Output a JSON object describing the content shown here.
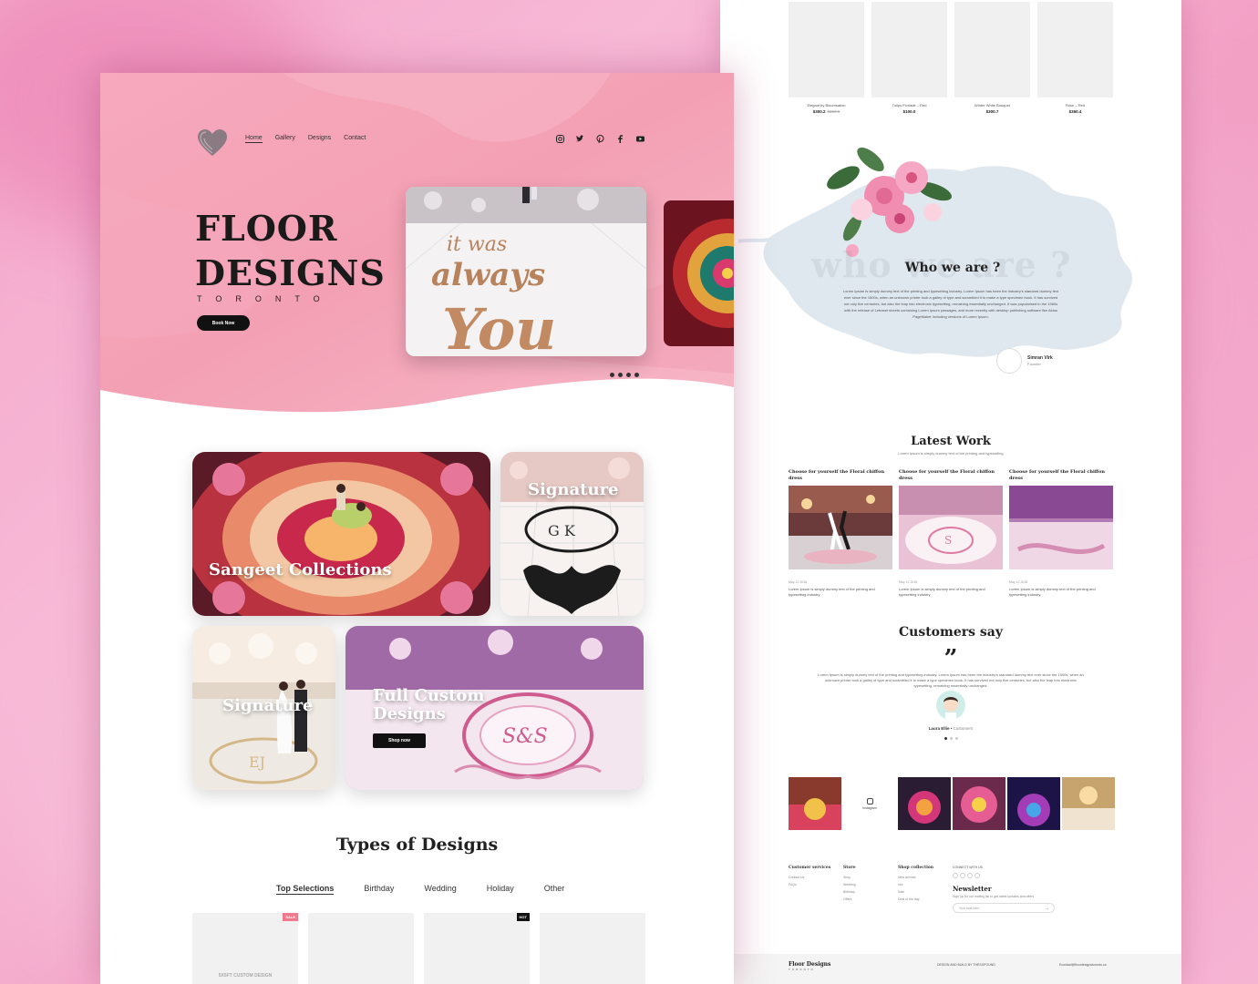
{
  "left": {
    "nav": [
      "Home",
      "Gallery",
      "Designs",
      "Contact"
    ],
    "social": [
      "instagram-icon",
      "twitter-icon",
      "pinterest-icon",
      "facebook-icon",
      "youtube-icon"
    ],
    "hero": {
      "title_line1": "FLOOR",
      "title_line2": "DESIGNS",
      "subtitle": "TORONTO",
      "cta": "Book Now",
      "slide_script_top": "it was",
      "slide_script_mid": "always",
      "slide_script_bottom": "You"
    },
    "collections": {
      "sangeet": "Sangeet Collections",
      "signature_top": "Signature",
      "signature_bottom": "Signature",
      "custom_line1": "Full Custom",
      "custom_line2": "Designs",
      "shop_now": "Shop now",
      "monogram_top": "G K",
      "monogram_custom": "S&S",
      "monogram_signature": "EJ"
    },
    "types": {
      "title": "Types of Designs",
      "tabs": [
        "Top Selections",
        "Birthday",
        "Wedding",
        "Holiday",
        "Other"
      ],
      "badges": [
        "SALE",
        "HOT"
      ],
      "first_card_name": "5X5FT CUSTOM DESIGN"
    }
  },
  "right": {
    "products": [
      {
        "name": "Elegant by Bloomsation",
        "price": "$300.2",
        "old_price": "$350.6"
      },
      {
        "name": "Tulips Floriade – Red",
        "price": "$100.0",
        "old_price": ""
      },
      {
        "name": "Winter White Bouquet",
        "price": "$300.7",
        "old_price": ""
      },
      {
        "name": "Rose – Red",
        "price": "$350.4",
        "old_price": ""
      }
    ],
    "who": {
      "ghost": "who we are ?",
      "title": "Who we are ?",
      "text": "Lorem Ipsum is simply dummy text of the printing and typesetting industry. Lorem Ipsum has been the industry's standard dummy text ever since the 1500s, when an unknown printer took a galley of type and scrambled it to make a type specimen book. It has survived not only five centuries, but also the leap into electronic typesetting, remaining essentially unchanged. It was popularised in the 1960s with the release of Letraset sheets containing Lorem Ipsum passages, and more recently with desktop publishing software like Aldus PageMaker including versions of Lorem Ipsum.",
      "name": "Simran Virk",
      "role": "Founder"
    },
    "latest": {
      "title": "Latest Work",
      "subtitle": "Lorem Ipsum is simply dummy text of the printing and typesetting",
      "items": [
        {
          "head": "Choose for yourself the Floral chiffon dress",
          "date": "May 12 2018",
          "text": "Lorem Ipsum is simply dummy text of the printing and typesetting industry."
        },
        {
          "head": "Choose for yourself the Floral chiffon dress",
          "date": "May 12 2018",
          "text": "Lorem Ipsum is simply dummy text of the printing and typesetting industry."
        },
        {
          "head": "Choose for yourself the Floral chiffon dress",
          "date": "May 12 2018",
          "text": "Lorem Ipsum is simply dummy text of the printing and typesetting industry."
        }
      ]
    },
    "customers": {
      "title": "Customers say",
      "quote": "”",
      "text": "Lorem Ipsum is simply dummy text of the printing and typesetting industry. Lorem Ipsum has been the industry's standard dummy text ever since the 1500s, when an unknown printer took a galley of type and scrambled it to make a type specimen book. It has survived not only five centuries, but also the leap into electronic typesetting, remaining essentially unchanged.",
      "name": "Laura Ellie",
      "role": "Customers"
    },
    "instagram_label": "Instagram",
    "footer": {
      "col1_head": "Customer services",
      "col1_items": [
        "Contact Us",
        "FAQs"
      ],
      "col2_head": "Store",
      "col2_items": [
        "Shop",
        "Wedding",
        "Birthday",
        "Offers"
      ],
      "col3_head": "Shop collection",
      "col3_items": [
        "New Arrivals",
        "Hot",
        "Sale",
        "Deal of the day"
      ],
      "connect": "CONNECT WITH US",
      "newsletter": "Newsletter",
      "newsletter_sub": "Sign up for our mailing list to get latest updates and offers",
      "email_placeholder": "Your mail here",
      "brand": "Floor Designs",
      "brand_sub": "TORONTO",
      "credit": "DESIGN AND BUILD BY THESOFOUND",
      "email": "Econtact@floordesignstoronto.ca"
    }
  }
}
